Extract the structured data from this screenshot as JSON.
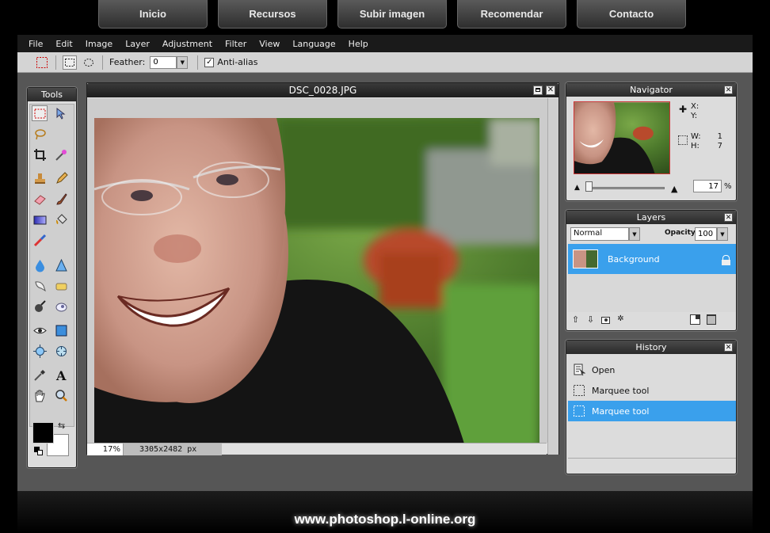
{
  "site_nav": [
    "Inicio",
    "Recursos",
    "Subir imagen",
    "Recomendar",
    "Contacto"
  ],
  "menu": [
    "File",
    "Edit",
    "Image",
    "Layer",
    "Adjustment",
    "Filter",
    "View",
    "Language",
    "Help"
  ],
  "options": {
    "feather_label": "Feather:",
    "feather_value": "0",
    "antialias_label": "Anti-alias"
  },
  "tools_panel": {
    "title": "Tools"
  },
  "document": {
    "title": "DSC_0028.JPG",
    "zoom": "17",
    "zoom_unit": "%",
    "size": "3305x2482 px"
  },
  "navigator": {
    "title": "Navigator",
    "x_label": "X:",
    "y_label": "Y:",
    "w_label": "W:",
    "w_value": "1",
    "h_label": "H:",
    "h_value": "7",
    "zoom": "17",
    "zoom_unit": "%"
  },
  "layers": {
    "title": "Layers",
    "blend_mode": "Normal",
    "opacity_label": "Opacity:",
    "opacity_value": "100",
    "items": [
      {
        "name": "Background"
      }
    ]
  },
  "history": {
    "title": "History",
    "items": [
      {
        "label": "Open"
      },
      {
        "label": "Marquee tool"
      },
      {
        "label": "Marquee tool"
      }
    ]
  },
  "footer": {
    "url": "www.photoshop.l-online.org"
  },
  "colors": {
    "accent": "#3a9be8",
    "selected_row": "#3aa0ec",
    "panel_header": "#333333"
  }
}
